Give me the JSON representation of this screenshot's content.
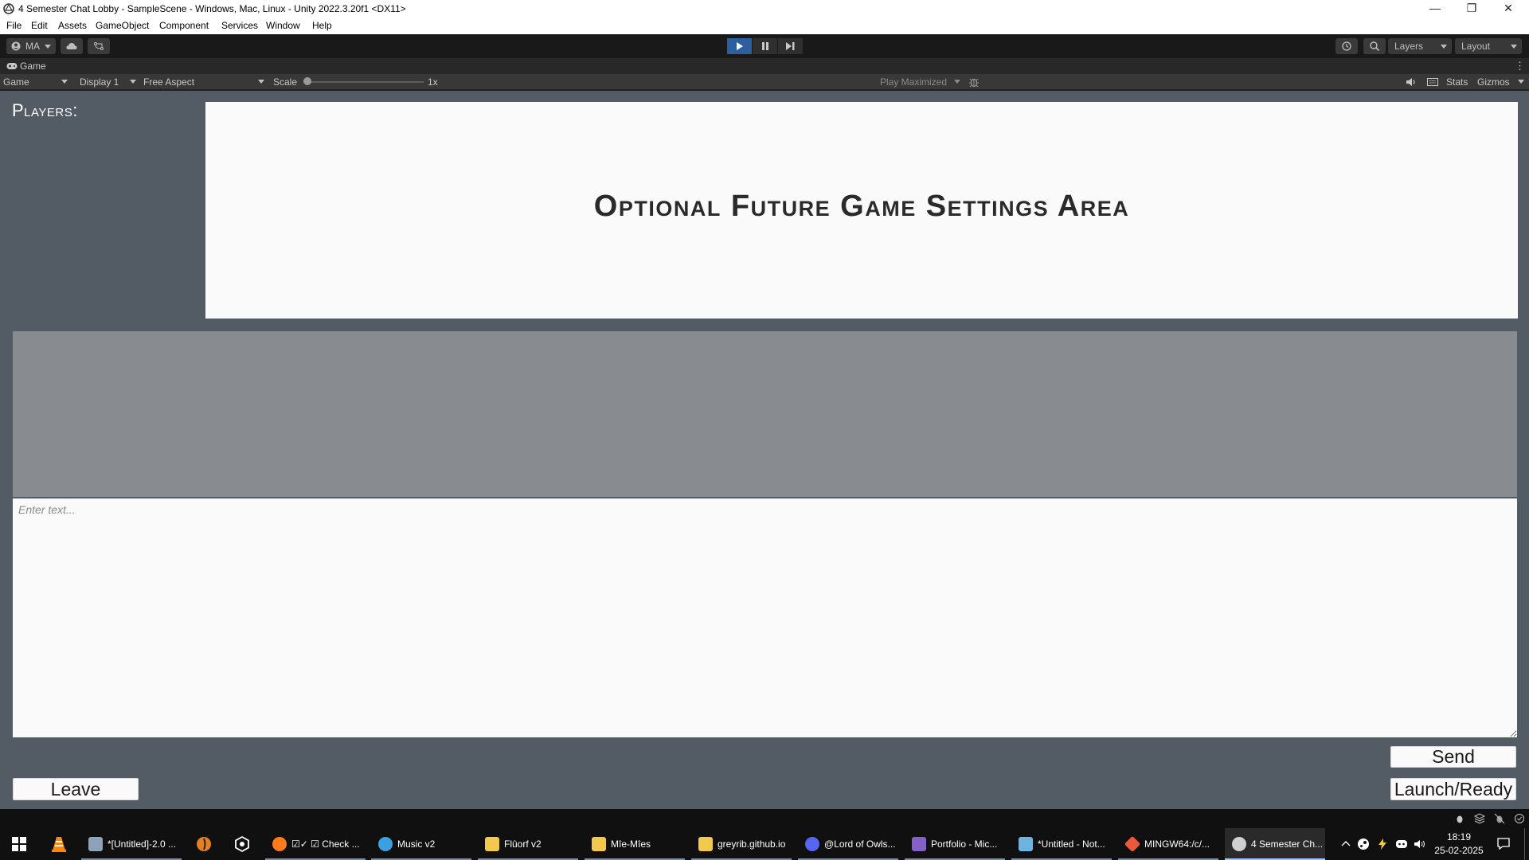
{
  "window": {
    "title": "4 Semester Chat Lobby - SampleScene - Windows, Mac, Linux - Unity 2022.3.20f1 <DX11>",
    "minimize": "—",
    "restore": "❐",
    "close": "✕"
  },
  "menu": [
    "File",
    "Edit",
    "Assets",
    "GameObject",
    "Component",
    "Services",
    "Window",
    "Help"
  ],
  "toolbar": {
    "account": "MA",
    "layers": "Layers",
    "layout": "Layout"
  },
  "tab": {
    "label": "Game"
  },
  "gamebar": {
    "mode": "Game",
    "display": "Display 1",
    "aspect": "Free Aspect",
    "scale_label": "Scale",
    "scale_value": "1x",
    "scale_fraction": 0.0,
    "play_maximized": "Play Maximized",
    "stats": "Stats",
    "gizmos": "Gizmos"
  },
  "game": {
    "players_label": "Players:",
    "settings_title": "Optional Future Game Settings Area",
    "chat_placeholder": "Enter text...",
    "send_label": "Send",
    "leave_label": "Leave",
    "launch_label": "Launch/Ready"
  },
  "taskbar": {
    "items": [
      {
        "label": "*[Untitled]-2.0 ...",
        "color": "#8fa3b8"
      },
      {
        "label": "☑✓ ☑ Check ...",
        "color": "#ff7a1a"
      },
      {
        "label": "Music v2",
        "color": "#3aa0e0"
      },
      {
        "label": "Flûorf v2",
        "color": "#f2c94c"
      },
      {
        "label": "Mîe-Mîes",
        "color": "#f2c94c"
      },
      {
        "label": "greyrib.github.io",
        "color": "#f2c94c"
      },
      {
        "label": "@Lord of Owls...",
        "color": "#5865f2"
      },
      {
        "label": "Portfolio - Mic...",
        "color": "#8661c5"
      },
      {
        "label": "*Untitled - Not...",
        "color": "#6fb3e0"
      },
      {
        "label": "MINGW64:/c/...",
        "color": "#e9593a"
      },
      {
        "label": "4 Semester Ch...",
        "color": "#d0d0d0"
      }
    ],
    "time": "18:19",
    "date": "25-02-2025"
  }
}
